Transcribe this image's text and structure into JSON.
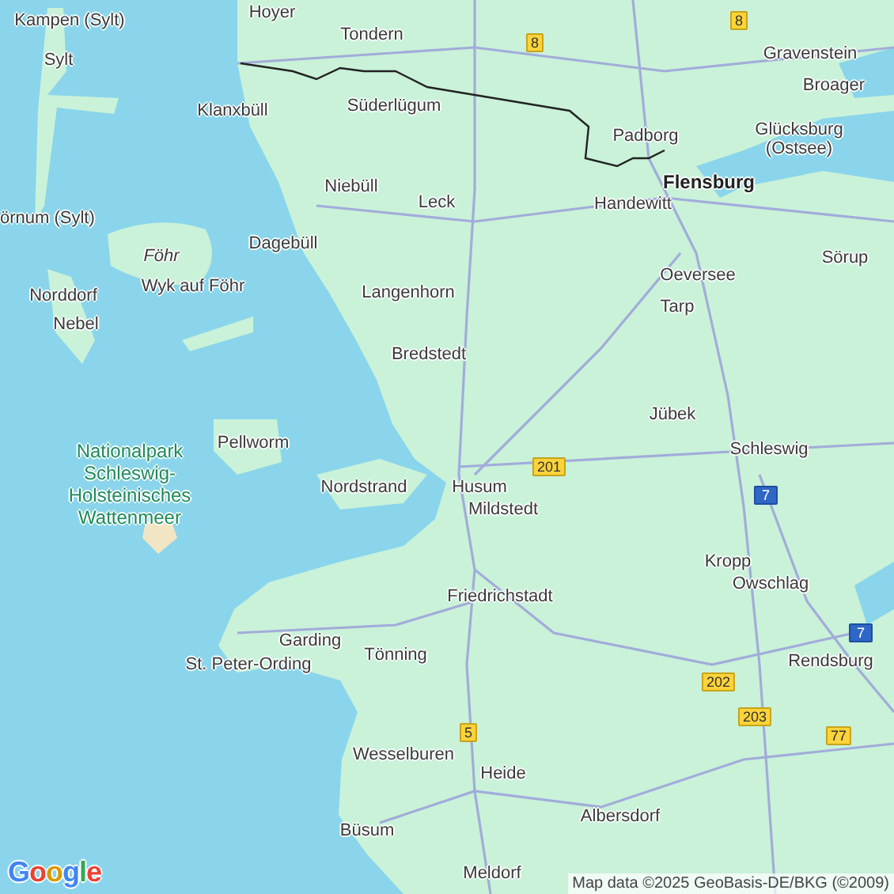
{
  "map": {
    "labels": [
      {
        "text": "Hoyer",
        "kind": "town"
      },
      {
        "text": "Tondern",
        "kind": "town"
      },
      {
        "text": "Kampen (Sylt)",
        "kind": "town"
      },
      {
        "text": "Sylt",
        "kind": "town"
      },
      {
        "text": "Klanxbüll",
        "kind": "town"
      },
      {
        "text": "Süderlügum",
        "kind": "town"
      },
      {
        "text": "Niebüll",
        "kind": "town"
      },
      {
        "text": "Leck",
        "kind": "town"
      },
      {
        "text": "örnum (Sylt)",
        "kind": "town"
      },
      {
        "text": "Dagebüll",
        "kind": "town"
      },
      {
        "text": "Föhr",
        "kind": "island"
      },
      {
        "text": "Wyk auf Föhr",
        "kind": "town"
      },
      {
        "text": "Norddorf",
        "kind": "town"
      },
      {
        "text": "Nebel",
        "kind": "town"
      },
      {
        "text": "Langenhorn",
        "kind": "town"
      },
      {
        "text": "Bredstedt",
        "kind": "town"
      },
      {
        "text": "Pellworm",
        "kind": "town"
      },
      {
        "text": "Nationalpark Schleswig-Holsteinisches Wattenmeer",
        "kind": "park"
      },
      {
        "text": "Nordstrand",
        "kind": "town"
      },
      {
        "text": "Husum",
        "kind": "town"
      },
      {
        "text": "Mildstedt",
        "kind": "town"
      },
      {
        "text": "Friedrichstadt",
        "kind": "town"
      },
      {
        "text": "Garding",
        "kind": "town"
      },
      {
        "text": "Tönning",
        "kind": "town"
      },
      {
        "text": "St. Peter-Ording",
        "kind": "town"
      },
      {
        "text": "Wesselburen",
        "kind": "town"
      },
      {
        "text": "Heide",
        "kind": "town"
      },
      {
        "text": "Büsum",
        "kind": "town"
      },
      {
        "text": "Albersdorf",
        "kind": "town"
      },
      {
        "text": "Meldorf",
        "kind": "town"
      },
      {
        "text": "Gravenstein",
        "kind": "town"
      },
      {
        "text": "Broager",
        "kind": "town"
      },
      {
        "text": "Padborg",
        "kind": "town"
      },
      {
        "text": "Glücksburg (Ostsee)",
        "kind": "town"
      },
      {
        "text": "Flensburg",
        "kind": "city"
      },
      {
        "text": "Handewitt",
        "kind": "town"
      },
      {
        "text": "Sörup",
        "kind": "town"
      },
      {
        "text": "Oeversee",
        "kind": "town"
      },
      {
        "text": "Tarp",
        "kind": "town"
      },
      {
        "text": "Jübek",
        "kind": "town"
      },
      {
        "text": "Schleswig",
        "kind": "town"
      },
      {
        "text": "Kropp",
        "kind": "town"
      },
      {
        "text": "Owschlag",
        "kind": "town"
      },
      {
        "text": "Rendsburg",
        "kind": "town"
      }
    ],
    "road_shields": [
      {
        "text": "8",
        "kind": "federal"
      },
      {
        "text": "8",
        "kind": "federal"
      },
      {
        "text": "201",
        "kind": "federal"
      },
      {
        "text": "7",
        "kind": "motorway"
      },
      {
        "text": "7",
        "kind": "motorway"
      },
      {
        "text": "202",
        "kind": "federal"
      },
      {
        "text": "203",
        "kind": "federal"
      },
      {
        "text": "77",
        "kind": "federal"
      },
      {
        "text": "5",
        "kind": "federal"
      }
    ],
    "logo": "Google",
    "attribution": "Map data ©2025 GeoBasis-DE/BKG (©2009)"
  }
}
